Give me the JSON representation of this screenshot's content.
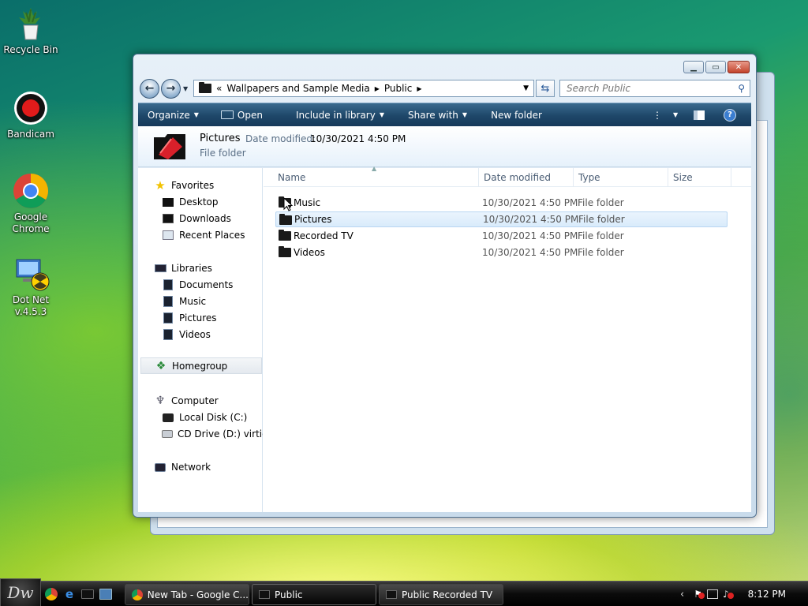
{
  "desktop": {
    "icons": [
      {
        "label": "Recycle Bin",
        "icon": "recycle-bin-icon"
      },
      {
        "label": "Bandicam",
        "icon": "bandicam-icon"
      },
      {
        "label": "Google Chrome",
        "icon": "chrome-icon"
      },
      {
        "label": "Dot Net v.4.5.3",
        "icon": "dotnet-installer-icon"
      }
    ]
  },
  "window": {
    "address": {
      "overflow": "«",
      "crumbs": [
        "Wallpapers and Sample Media",
        "Public"
      ]
    },
    "search_placeholder": "Search Public",
    "toolbar": {
      "organize": "Organize",
      "open": "Open",
      "include_in_library": "Include in library",
      "share_with": "Share with",
      "new_folder": "New folder"
    },
    "details": {
      "name": "Pictures",
      "modified_label": "Date modified:",
      "modified_value": "10/30/2021 4:50 PM",
      "type": "File folder"
    },
    "nav": {
      "favorites": {
        "label": "Favorites",
        "items": [
          "Desktop",
          "Downloads",
          "Recent Places"
        ]
      },
      "libraries": {
        "label": "Libraries",
        "items": [
          "Documents",
          "Music",
          "Pictures",
          "Videos"
        ]
      },
      "homegroup": "Homegroup",
      "computer": {
        "label": "Computer",
        "items": [
          "Local Disk (C:)",
          "CD Drive (D:) virtio-w"
        ]
      },
      "network": "Network"
    },
    "columns": {
      "name": "Name",
      "date": "Date modified",
      "type": "Type",
      "size": "Size"
    },
    "files": [
      {
        "name": "Music",
        "date": "10/30/2021 4:50 PM",
        "type": "File folder"
      },
      {
        "name": "Pictures",
        "date": "10/30/2021 4:50 PM",
        "type": "File folder",
        "selected": true
      },
      {
        "name": "Recorded TV",
        "date": "10/30/2021 4:50 PM",
        "type": "File folder"
      },
      {
        "name": "Videos",
        "date": "10/30/2021 4:50 PM",
        "type": "File folder"
      }
    ]
  },
  "taskbar": {
    "start_label": "Dw",
    "tasks": [
      "New Tab - Google C...",
      "Public",
      "Public Recorded TV"
    ],
    "clock": "8:12 PM"
  }
}
